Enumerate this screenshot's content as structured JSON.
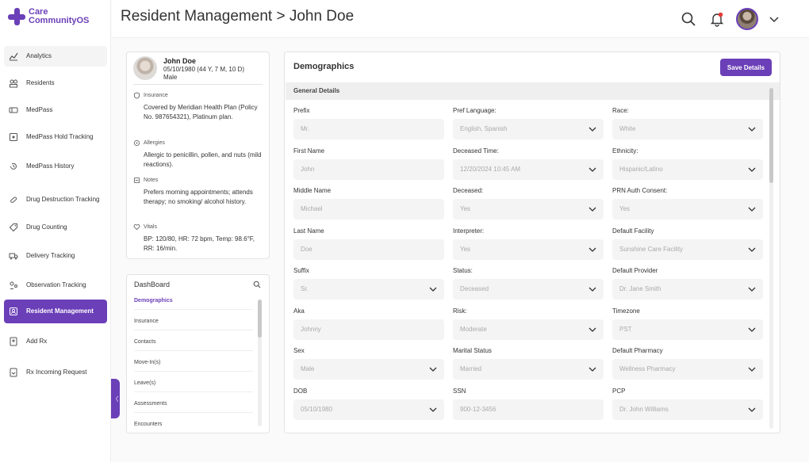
{
  "brand": {
    "line1": "Care",
    "line2": "CommunityOS"
  },
  "header": {
    "title": "Resident Management > John Doe"
  },
  "sidebar": {
    "items": [
      {
        "label": "Analytics",
        "icon": "chart-line-icon"
      },
      {
        "label": "Residents",
        "icon": "users-icon"
      },
      {
        "label": "MedPass",
        "icon": "pill-card-icon"
      },
      {
        "label": "MedPass Hold Tracking",
        "icon": "hold-tracking-icon"
      },
      {
        "label": "MedPass History",
        "icon": "history-icon"
      },
      {
        "label": "Drug Destruction Tracking",
        "icon": "drug-destruction-icon"
      },
      {
        "label": "Drug Counting",
        "icon": "tag-icon"
      },
      {
        "label": "Delivery Tracking",
        "icon": "truck-icon"
      },
      {
        "label": "Observation Tracking",
        "icon": "observation-icon"
      },
      {
        "label": "Resident Management",
        "icon": "resident-management-icon"
      },
      {
        "label": "Add Rx",
        "icon": "add-rx-icon"
      },
      {
        "label": "Rx Incoming Request",
        "icon": "rx-request-icon"
      }
    ],
    "active": "Resident Management",
    "collapse_glyph": "〈"
  },
  "profile": {
    "name": "John Doe",
    "dob_age": "05/10/1980 (44 Y, 7 M, 10 D)",
    "gender": "Male",
    "insurance_label": "Insurance",
    "insurance_text": "Covered by Meridian Health Plan (Policy No. 987654321), Platinum plan.",
    "allergies_label": "Allergies",
    "allergies_text": "Allergic to penicillin, pollen, and nuts (mild reactions).",
    "notes_label": "Notes",
    "notes_text": "Prefers morning appointments; attends therapy; no smoking/ alcohol history.",
    "vitals_label": "Vitals",
    "vitals_text": "BP: 120/80, HR: 72 bpm, Temp: 98.6°F, RR: 16/min."
  },
  "dashboard": {
    "title": "DashBoard",
    "items": [
      "Demographics",
      "Insurance",
      "Contacts",
      "Move-In(s)",
      "Leave(s)",
      "Assessments",
      "Encounters"
    ],
    "active": "Demographics"
  },
  "demographics": {
    "title": "Demographics",
    "save_label": "Save Details",
    "section_label": "General Details",
    "fields": [
      {
        "label": "Prefix",
        "value": "Mr.",
        "dropdown": false
      },
      {
        "label": "Pref Language:",
        "value": "English, Spanish",
        "dropdown": true
      },
      {
        "label": "Race:",
        "value": "White",
        "dropdown": true
      },
      {
        "label": "First Name",
        "value": "John",
        "dropdown": false
      },
      {
        "label": "Deceased Time:",
        "value": "12/20/2024 10:45 AM",
        "dropdown": true
      },
      {
        "label": "Ethnicity:",
        "value": "Hispanic/Latino",
        "dropdown": true
      },
      {
        "label": "Middle Name",
        "value": "Michael",
        "dropdown": false
      },
      {
        "label": "Deceased:",
        "value": "Yes",
        "dropdown": true
      },
      {
        "label": "PRN Auth Consent:",
        "value": "Yes",
        "dropdown": true
      },
      {
        "label": "Last Name",
        "value": "Doe",
        "dropdown": false
      },
      {
        "label": "Interpreter:",
        "value": "Yes",
        "dropdown": true
      },
      {
        "label": "Default Facility",
        "value": "Sunshine Care Facility",
        "dropdown": true
      },
      {
        "label": "Suffix",
        "value": "Sr.",
        "dropdown": true
      },
      {
        "label": "Status:",
        "value": "Deceased",
        "dropdown": true
      },
      {
        "label": "Default Provider",
        "value": "Dr. Jane Smith",
        "dropdown": true
      },
      {
        "label": "Aka",
        "value": "Johnny",
        "dropdown": false
      },
      {
        "label": "Risk:",
        "value": "Moderate",
        "dropdown": true
      },
      {
        "label": "Timezone",
        "value": "PST",
        "dropdown": true
      },
      {
        "label": "Sex",
        "value": "Male",
        "dropdown": true
      },
      {
        "label": "Marital Status",
        "value": "Married",
        "dropdown": true
      },
      {
        "label": "Default Pharmacy",
        "value": "Wellness Pharmacy",
        "dropdown": true
      },
      {
        "label": "DOB",
        "value": "05/10/1980",
        "dropdown": true
      },
      {
        "label": "SSN",
        "value": "900-12-3456",
        "dropdown": false
      },
      {
        "label": "PCP",
        "value": "Dr. John Williams",
        "dropdown": true
      }
    ]
  }
}
